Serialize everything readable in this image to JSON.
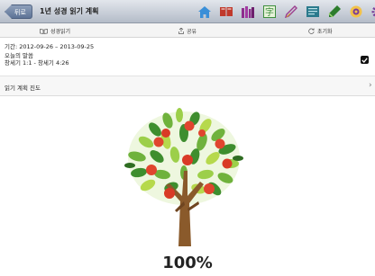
{
  "navbar": {
    "back_label": "뒤로",
    "title": "1년 성경 읽기 계획",
    "icons": [
      {
        "name": "home-icon",
        "color": "#3a8fd8"
      },
      {
        "name": "book-icon",
        "color": "#c0392b"
      },
      {
        "name": "library-icon",
        "color": "#8e2e8e"
      },
      {
        "name": "dictionary-icon",
        "color": "#3e8e3e"
      },
      {
        "name": "pen-icon",
        "color": "#9b3d8f"
      },
      {
        "name": "notes-icon",
        "color": "#2b7a8c"
      },
      {
        "name": "highlighter-icon",
        "color": "#2d7d2d"
      },
      {
        "name": "bible-reading-icon",
        "color": "#d88a1f"
      },
      {
        "name": "settings-icon",
        "color": "#7a3d9a"
      }
    ]
  },
  "tabs": {
    "bible_reading": "성경읽기",
    "share": "공유",
    "reset": "초기화"
  },
  "plan": {
    "period": "기간: 2012-09-26 – 2013-09-25",
    "today_heading": "오늘의 말씀",
    "today_reading": "창세기 1:1 - 창세기 4:26"
  },
  "progress": {
    "label": "읽기 계획 진도",
    "value": 1.0,
    "percent_text": "100%"
  }
}
